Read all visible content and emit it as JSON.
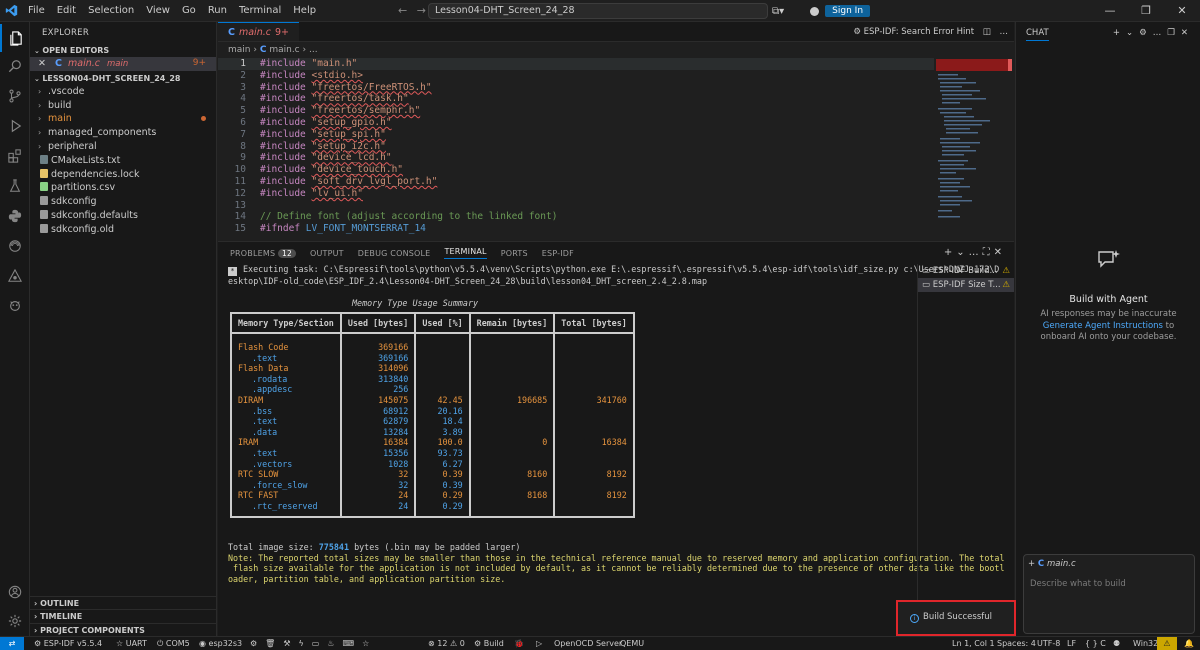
{
  "titlebar": {
    "menu": [
      "File",
      "Edit",
      "Selection",
      "View",
      "Go",
      "Run",
      "Terminal",
      "Help"
    ],
    "search_text": "Lesson04-DHT_Screen_24_28",
    "signin_label": "Sign In"
  },
  "explorer": {
    "title": "EXPLORER",
    "open_editors_label": "OPEN EDITORS",
    "open_file": {
      "name": "main.c",
      "folder": "main",
      "badge": "9+"
    },
    "project_label": "LESSON04-DHT_SCREEN_24_28",
    "items": [
      {
        "name": ".vscode",
        "type": "folder"
      },
      {
        "name": "build",
        "type": "folder"
      },
      {
        "name": "main",
        "type": "folder"
      },
      {
        "name": "managed_components",
        "type": "folder"
      },
      {
        "name": "peripheral",
        "type": "folder"
      },
      {
        "name": "CMakeLists.txt",
        "type": "file"
      },
      {
        "name": "dependencies.lock",
        "type": "file"
      },
      {
        "name": "partitions.csv",
        "type": "file"
      },
      {
        "name": "sdkconfig",
        "type": "file"
      },
      {
        "name": "sdkconfig.defaults",
        "type": "file"
      },
      {
        "name": "sdkconfig.old",
        "type": "file"
      }
    ],
    "bottom_sections": [
      "OUTLINE",
      "TIMELINE",
      "PROJECT COMPONENTS"
    ]
  },
  "editor": {
    "tab_label": "main.c",
    "tab_badge": "9+",
    "right_label": "ESP-IDF: Search Error Hint",
    "breadcrumb_folder": "main",
    "breadcrumb_file": "main.c",
    "breadcrumb_more": "...",
    "lines": [
      {
        "n": "1",
        "kw": "#include",
        "arg": "\"main.h\""
      },
      {
        "n": "2",
        "kw": "#include",
        "arg": "<stdio.h>"
      },
      {
        "n": "3",
        "kw": "#include",
        "arg": "\"freertos/FreeRTOS.h\""
      },
      {
        "n": "4",
        "kw": "#include",
        "arg": "\"freertos/task.h\""
      },
      {
        "n": "5",
        "kw": "#include",
        "arg": "\"freertos/semphr.h\""
      },
      {
        "n": "6",
        "kw": "#include",
        "arg": "\"setup_gpio.h\""
      },
      {
        "n": "7",
        "kw": "#include",
        "arg": "\"setup_spi.h\""
      },
      {
        "n": "8",
        "kw": "#include",
        "arg": "\"setup_i2c.h\""
      },
      {
        "n": "9",
        "kw": "#include",
        "arg": "\"device_lcd.h\""
      },
      {
        "n": "10",
        "kw": "#include",
        "arg": "\"device_touch.h\""
      },
      {
        "n": "11",
        "kw": "#include",
        "arg": "\"soft_drv_lvgl_port.h\""
      },
      {
        "n": "12",
        "kw": "#include",
        "arg": "\"lv_ui.h\""
      },
      {
        "n": "13",
        "kw": "",
        "arg": ""
      },
      {
        "n": "14",
        "kw": "",
        "arg": "// Define font (adjust according to the linked font)"
      },
      {
        "n": "15",
        "kw": "#ifndef",
        "arg": "LV_FONT_MONTSERRAT_14"
      }
    ]
  },
  "panel": {
    "tabs": [
      "PROBLEMS",
      "OUTPUT",
      "DEBUG CONSOLE",
      "TERMINAL",
      "PORTS",
      "ESP-IDF"
    ],
    "problems_count": "12",
    "terminal": {
      "task_line_1": "Executing task: C:\\Espressif\\tools\\python\\v5.5.4\\venv\\Scripts\\python.exe E:\\.espressif\\.espressif\\v5.5.4\\esp-idf\\tools\\idf_size.py c:\\Users\\DNZJ-172\\D",
      "task_line_2": "esktop\\IDF-old_code\\ESP_IDF_2.4\\Lesson04-DHT_Screen_24_28\\build\\lesson04_DHT_screen_2.4_2.8.map",
      "table_title": "Memory Type Usage Summary",
      "headers": [
        "Memory Type/Section",
        "Used [bytes]",
        "Used [%]",
        "Remain [bytes]",
        "Total [bytes]"
      ],
      "rows": [
        {
          "name": "Flash Code",
          "indent": false,
          "used": "369166",
          "pct": "",
          "remain": "",
          "total": ""
        },
        {
          "name": ".text",
          "indent": true,
          "used": "369166",
          "pct": "",
          "remain": "",
          "total": ""
        },
        {
          "name": "Flash Data",
          "indent": false,
          "used": "314096",
          "pct": "",
          "remain": "",
          "total": ""
        },
        {
          "name": ".rodata",
          "indent": true,
          "used": "313840",
          "pct": "",
          "remain": "",
          "total": ""
        },
        {
          "name": ".appdesc",
          "indent": true,
          "used": "256",
          "pct": "",
          "remain": "",
          "total": ""
        },
        {
          "name": "DIRAM",
          "indent": false,
          "used": "145075",
          "pct": "42.45",
          "remain": "196685",
          "total": "341760"
        },
        {
          "name": ".bss",
          "indent": true,
          "used": "68912",
          "pct": "20.16",
          "remain": "",
          "total": ""
        },
        {
          "name": ".text",
          "indent": true,
          "used": "62879",
          "pct": "18.4",
          "remain": "",
          "total": ""
        },
        {
          "name": ".data",
          "indent": true,
          "used": "13284",
          "pct": "3.89",
          "remain": "",
          "total": ""
        },
        {
          "name": "IRAM",
          "indent": false,
          "used": "16384",
          "pct": "100.0",
          "remain": "0",
          "total": "16384"
        },
        {
          "name": ".text",
          "indent": true,
          "used": "15356",
          "pct": "93.73",
          "remain": "",
          "total": ""
        },
        {
          "name": ".vectors",
          "indent": true,
          "used": "1028",
          "pct": "6.27",
          "remain": "",
          "total": ""
        },
        {
          "name": "RTC SLOW",
          "indent": false,
          "used": "32",
          "pct": "0.39",
          "remain": "8160",
          "total": "8192"
        },
        {
          "name": ".force_slow",
          "indent": true,
          "used": "32",
          "pct": "0.39",
          "remain": "",
          "total": ""
        },
        {
          "name": "RTC FAST",
          "indent": false,
          "used": "24",
          "pct": "0.29",
          "remain": "8168",
          "total": "8192"
        },
        {
          "name": ".rtc_reserved",
          "indent": true,
          "used": "24",
          "pct": "0.29",
          "remain": "",
          "total": ""
        }
      ],
      "total_prefix": "Total image size: ",
      "total_value": "775841",
      "total_suffix": " bytes (.bin may be padded larger)",
      "note_1": "Note: The reported total sizes may be smaller than those in the technical reference manual due to reserved memory and application configuration. The total",
      "note_2": " flash size available for the application is not included by default, as it cannot be reliably determined due to the presence of other data like the bootl",
      "note_3": "oader, partition table, and application partition size."
    },
    "terminal_list": [
      "ESP-IDF Build...",
      "ESP-IDF Size T..."
    ]
  },
  "chat": {
    "title": "CHAT",
    "agent_title": "Build with Agent",
    "agent_desc_1": "AI responses may be inaccurate",
    "agent_link": "Generate Agent Instructions",
    "agent_desc_2": " to onboard AI onto your codebase.",
    "context_file": "main.c",
    "input_placeholder": "Describe what to build"
  },
  "toast": {
    "message": "Build Successful"
  },
  "statusbar": {
    "idf": "ESP-IDF v5.5.4",
    "uart": "UART",
    "port": "COM5",
    "target": "esp32s3",
    "errors": "12",
    "warnings": "0",
    "build": "Build",
    "openocd": "OpenOCD Server",
    "qemu": "QEMU",
    "position": "Ln 1, Col 1",
    "spaces": "Spaces: 4",
    "encoding": "UTF-8",
    "eol": "LF",
    "lang": "{ } C",
    "platform": "Win32"
  },
  "colors": {
    "accent": "#0078d4",
    "warning": "#cca700",
    "error": "#e0262b",
    "string": "#ce9178",
    "keyword": "#c586c0"
  }
}
